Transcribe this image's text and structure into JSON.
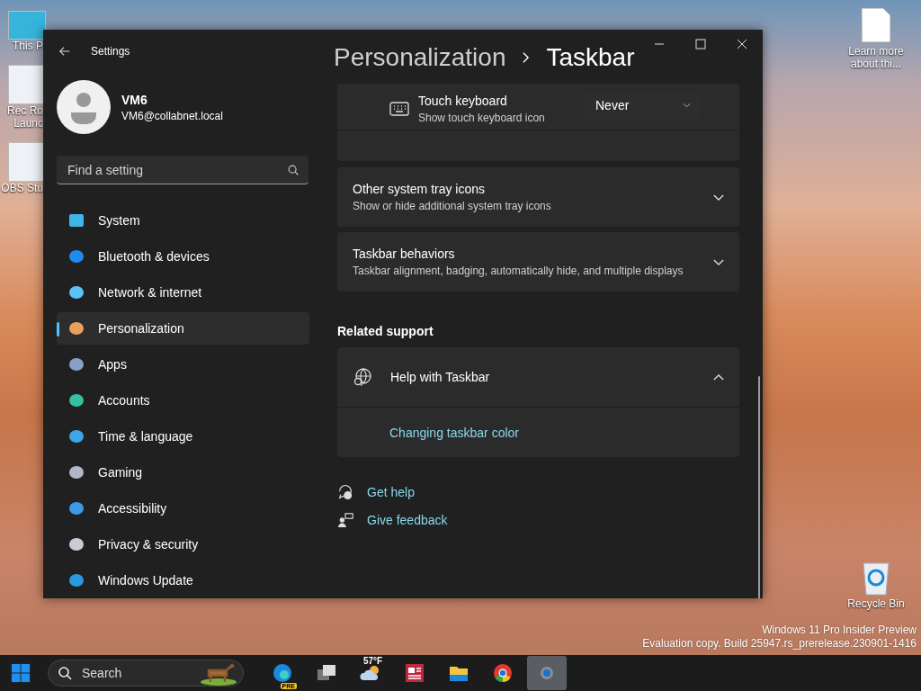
{
  "desktop": {
    "icons_left": [
      {
        "lines": [
          "This P"
        ]
      },
      {
        "lines": [
          "Rec Ro",
          "Launc"
        ]
      },
      {
        "lines": [
          "OBS Stu"
        ]
      }
    ],
    "icons_right": [
      {
        "kind": "file",
        "lines": [
          "Learn more",
          "about thi..."
        ]
      },
      {
        "kind": "recycle",
        "lines": [
          "Recycle Bin"
        ]
      }
    ],
    "watermark": [
      "Windows 11 Pro Insider Preview",
      "Evaluation copy. Build 25947.rs_prerelease.230901-1416"
    ]
  },
  "window": {
    "title": "Settings",
    "user": {
      "name": "VM6",
      "email": "VM6@collabnet.local"
    },
    "search": {
      "placeholder": "Find a setting"
    },
    "nav": [
      {
        "label": "System",
        "selected": false
      },
      {
        "label": "Bluetooth & devices",
        "selected": false
      },
      {
        "label": "Network & internet",
        "selected": false
      },
      {
        "label": "Personalization",
        "selected": true
      },
      {
        "label": "Apps",
        "selected": false
      },
      {
        "label": "Accounts",
        "selected": false
      },
      {
        "label": "Time & language",
        "selected": false
      },
      {
        "label": "Gaming",
        "selected": false
      },
      {
        "label": "Accessibility",
        "selected": false
      },
      {
        "label": "Privacy & security",
        "selected": false
      },
      {
        "label": "Windows Update",
        "selected": false
      }
    ],
    "breadcrumb": [
      "Personalization",
      "Taskbar"
    ],
    "touch_keyboard": {
      "title": "Touch keyboard",
      "subtitle": "Show touch keyboard icon",
      "value": "Never"
    },
    "expanders": [
      {
        "title": "Other system tray icons",
        "subtitle": "Show or hide additional system tray icons",
        "expanded": false
      },
      {
        "title": "Taskbar behaviors",
        "subtitle": "Taskbar alignment, badging, automatically hide, and multiple displays",
        "expanded": false
      }
    ],
    "related": {
      "heading": "Related support",
      "title": "Help with Taskbar",
      "expanded": true,
      "links": [
        "Changing taskbar color"
      ]
    },
    "footer_links": [
      "Get help",
      "Give feedback"
    ]
  },
  "taskbar": {
    "search": {
      "placeholder": "Search"
    },
    "apps": [
      {
        "kind": "edge",
        "badge": "PRE",
        "selected": false
      },
      {
        "kind": "taskview",
        "selected": false
      },
      {
        "kind": "weather",
        "text": "57°F",
        "selected": false
      },
      {
        "kind": "news",
        "selected": false
      },
      {
        "kind": "explorer",
        "selected": false
      },
      {
        "kind": "chrome",
        "selected": false
      },
      {
        "kind": "settings",
        "selected": true
      }
    ]
  }
}
